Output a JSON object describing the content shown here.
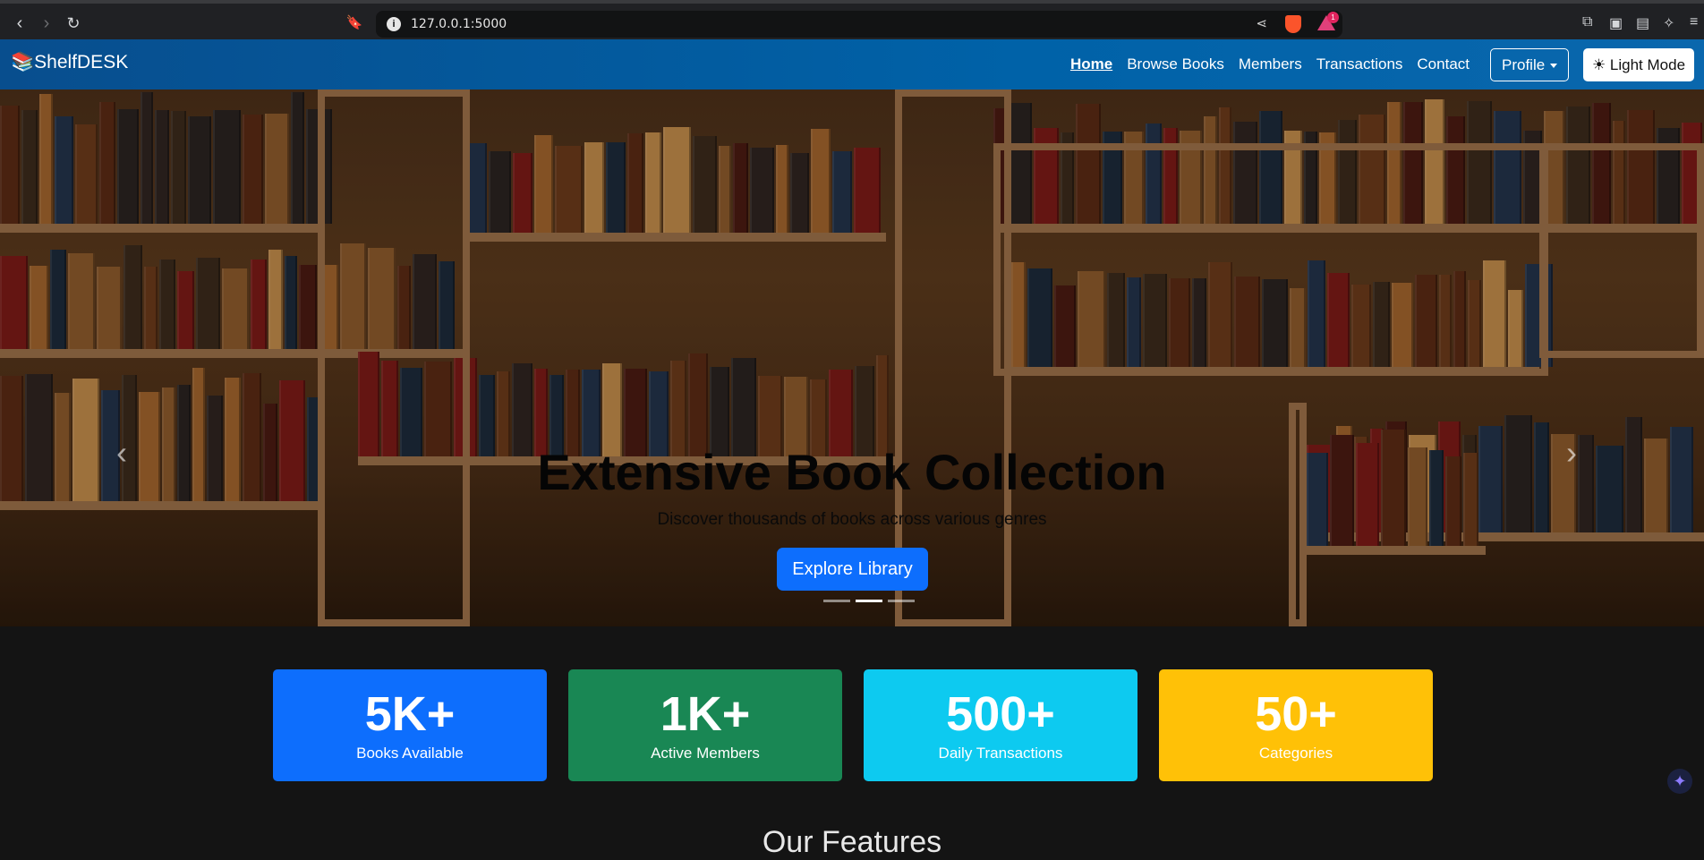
{
  "browser": {
    "url": "127.0.0.1:5000",
    "alert_count": "1"
  },
  "navbar": {
    "brand_icon": "📚",
    "brand": "ShelfDESK",
    "links": [
      "Home",
      "Browse Books",
      "Members",
      "Transactions",
      "Contact"
    ],
    "active_link": "Home",
    "profile_label": "Profile",
    "theme_toggle_label": "☀ Light Mode"
  },
  "hero": {
    "title": "Extensive Book Collection",
    "subtitle": "Discover thousands of books across various genres",
    "cta_label": "Explore Library",
    "active_slide": 2
  },
  "stats": [
    {
      "value": "5K+",
      "label": "Books Available",
      "color": "#0d6efd"
    },
    {
      "value": "1K+",
      "label": "Active Members",
      "color": "#198754"
    },
    {
      "value": "500+",
      "label": "Daily Transactions",
      "color": "#0dcaf0"
    },
    {
      "value": "50+",
      "label": "Categories",
      "color": "#ffc107"
    }
  ],
  "features": {
    "title": "Our Features"
  }
}
